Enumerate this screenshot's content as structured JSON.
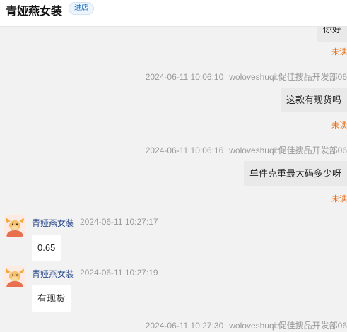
{
  "header": {
    "shop_name": "青娅燕女装",
    "enter_label": "进店"
  },
  "messages": {
    "m0": {
      "text": "你好",
      "status": "未读"
    },
    "m1": {
      "time": "2024-06-11 10:06:10",
      "sender": "woloveshuqi:促佳搜品开发部06",
      "text": "这款有现货吗",
      "status": "未读"
    },
    "m2": {
      "time": "2024-06-11 10:06:16",
      "sender": "woloveshuqi:促佳搜品开发部06",
      "text": "单件克重最大码多少呀",
      "status": "未读"
    },
    "m3": {
      "sender": "青娅燕女装",
      "time": "2024-06-11 10:27:17",
      "text": "0.65"
    },
    "m4": {
      "sender": "青娅燕女装",
      "time": "2024-06-11 10:27:19",
      "text": "有现货"
    },
    "m5": {
      "time": "2024-06-11 10:27:30",
      "sender": "woloveshuqi:促佳搜品开发部06"
    }
  },
  "colors": {
    "unread": "#e8690c",
    "shop_name_link": "#2b4a8c",
    "chat_background": "#f2f2f2"
  },
  "icons": {
    "avatar": "cartoon-bull-avatar-icon"
  }
}
